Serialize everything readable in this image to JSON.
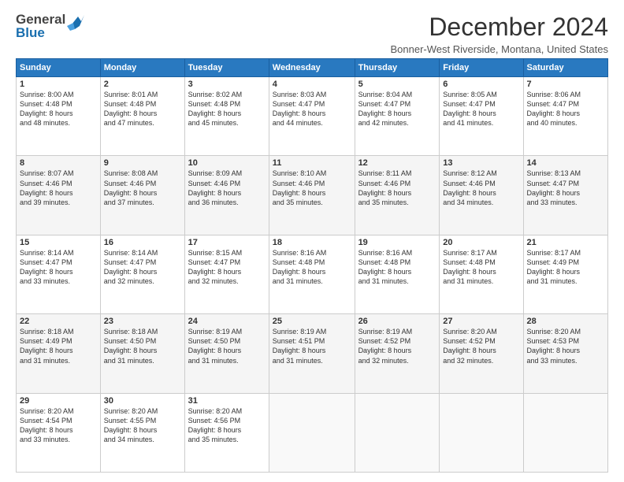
{
  "header": {
    "logo_general": "General",
    "logo_blue": "Blue",
    "title": "December 2024",
    "location": "Bonner-West Riverside, Montana, United States"
  },
  "days_of_week": [
    "Sunday",
    "Monday",
    "Tuesday",
    "Wednesday",
    "Thursday",
    "Friday",
    "Saturday"
  ],
  "weeks": [
    [
      {
        "day": "1",
        "sunrise": "8:00 AM",
        "sunset": "4:48 PM",
        "daylight": "8 hours and 48 minutes."
      },
      {
        "day": "2",
        "sunrise": "8:01 AM",
        "sunset": "4:48 PM",
        "daylight": "8 hours and 47 minutes."
      },
      {
        "day": "3",
        "sunrise": "8:02 AM",
        "sunset": "4:48 PM",
        "daylight": "8 hours and 45 minutes."
      },
      {
        "day": "4",
        "sunrise": "8:03 AM",
        "sunset": "4:47 PM",
        "daylight": "8 hours and 44 minutes."
      },
      {
        "day": "5",
        "sunrise": "8:04 AM",
        "sunset": "4:47 PM",
        "daylight": "8 hours and 42 minutes."
      },
      {
        "day": "6",
        "sunrise": "8:05 AM",
        "sunset": "4:47 PM",
        "daylight": "8 hours and 41 minutes."
      },
      {
        "day": "7",
        "sunrise": "8:06 AM",
        "sunset": "4:47 PM",
        "daylight": "8 hours and 40 minutes."
      }
    ],
    [
      {
        "day": "8",
        "sunrise": "8:07 AM",
        "sunset": "4:46 PM",
        "daylight": "8 hours and 39 minutes."
      },
      {
        "day": "9",
        "sunrise": "8:08 AM",
        "sunset": "4:46 PM",
        "daylight": "8 hours and 37 minutes."
      },
      {
        "day": "10",
        "sunrise": "8:09 AM",
        "sunset": "4:46 PM",
        "daylight": "8 hours and 36 minutes."
      },
      {
        "day": "11",
        "sunrise": "8:10 AM",
        "sunset": "4:46 PM",
        "daylight": "8 hours and 35 minutes."
      },
      {
        "day": "12",
        "sunrise": "8:11 AM",
        "sunset": "4:46 PM",
        "daylight": "8 hours and 35 minutes."
      },
      {
        "day": "13",
        "sunrise": "8:12 AM",
        "sunset": "4:46 PM",
        "daylight": "8 hours and 34 minutes."
      },
      {
        "day": "14",
        "sunrise": "8:13 AM",
        "sunset": "4:47 PM",
        "daylight": "8 hours and 33 minutes."
      }
    ],
    [
      {
        "day": "15",
        "sunrise": "8:14 AM",
        "sunset": "4:47 PM",
        "daylight": "8 hours and 33 minutes."
      },
      {
        "day": "16",
        "sunrise": "8:14 AM",
        "sunset": "4:47 PM",
        "daylight": "8 hours and 32 minutes."
      },
      {
        "day": "17",
        "sunrise": "8:15 AM",
        "sunset": "4:47 PM",
        "daylight": "8 hours and 32 minutes."
      },
      {
        "day": "18",
        "sunrise": "8:16 AM",
        "sunset": "4:48 PM",
        "daylight": "8 hours and 31 minutes."
      },
      {
        "day": "19",
        "sunrise": "8:16 AM",
        "sunset": "4:48 PM",
        "daylight": "8 hours and 31 minutes."
      },
      {
        "day": "20",
        "sunrise": "8:17 AM",
        "sunset": "4:48 PM",
        "daylight": "8 hours and 31 minutes."
      },
      {
        "day": "21",
        "sunrise": "8:17 AM",
        "sunset": "4:49 PM",
        "daylight": "8 hours and 31 minutes."
      }
    ],
    [
      {
        "day": "22",
        "sunrise": "8:18 AM",
        "sunset": "4:49 PM",
        "daylight": "8 hours and 31 minutes."
      },
      {
        "day": "23",
        "sunrise": "8:18 AM",
        "sunset": "4:50 PM",
        "daylight": "8 hours and 31 minutes."
      },
      {
        "day": "24",
        "sunrise": "8:19 AM",
        "sunset": "4:50 PM",
        "daylight": "8 hours and 31 minutes."
      },
      {
        "day": "25",
        "sunrise": "8:19 AM",
        "sunset": "4:51 PM",
        "daylight": "8 hours and 31 minutes."
      },
      {
        "day": "26",
        "sunrise": "8:19 AM",
        "sunset": "4:52 PM",
        "daylight": "8 hours and 32 minutes."
      },
      {
        "day": "27",
        "sunrise": "8:20 AM",
        "sunset": "4:52 PM",
        "daylight": "8 hours and 32 minutes."
      },
      {
        "day": "28",
        "sunrise": "8:20 AM",
        "sunset": "4:53 PM",
        "daylight": "8 hours and 33 minutes."
      }
    ],
    [
      {
        "day": "29",
        "sunrise": "8:20 AM",
        "sunset": "4:54 PM",
        "daylight": "8 hours and 33 minutes."
      },
      {
        "day": "30",
        "sunrise": "8:20 AM",
        "sunset": "4:55 PM",
        "daylight": "8 hours and 34 minutes."
      },
      {
        "day": "31",
        "sunrise": "8:20 AM",
        "sunset": "4:56 PM",
        "daylight": "8 hours and 35 minutes."
      },
      null,
      null,
      null,
      null
    ]
  ],
  "labels": {
    "sunrise": "Sunrise:",
    "sunset": "Sunset:",
    "daylight": "Daylight:"
  }
}
